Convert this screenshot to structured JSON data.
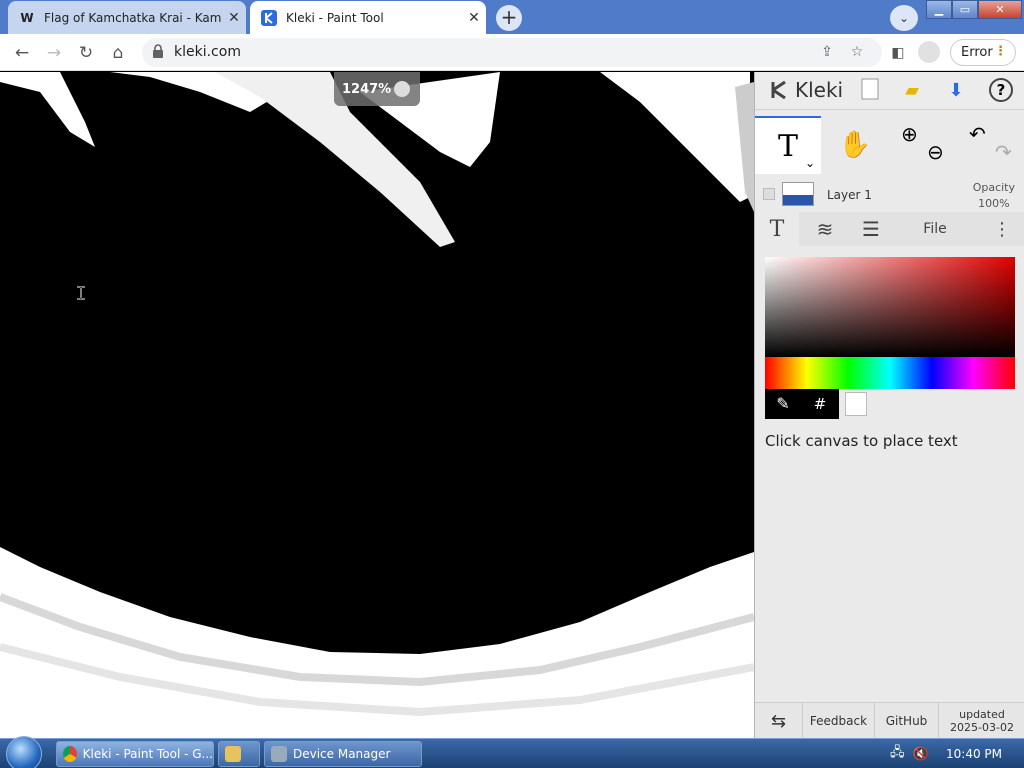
{
  "browser": {
    "tabs": [
      {
        "favicon": "W",
        "title": "Flag of Kamchatka Krai - Kamchatka",
        "active": false
      },
      {
        "favicon": "kleki-icon",
        "title": "Kleki - Paint Tool",
        "active": true
      }
    ],
    "url": "kleki.com",
    "error_label": "Error"
  },
  "canvas": {
    "zoom": "1247%"
  },
  "panel": {
    "logo": "Kleki",
    "layer": {
      "name": "Layer 1",
      "opacity_label": "Opacity",
      "opacity_value": "100%"
    },
    "tabs": {
      "text": "T",
      "file": "File"
    },
    "hex_label": "#",
    "hint": "Click canvas to place text",
    "footer": {
      "feedback": "Feedback",
      "github": "GitHub",
      "updated_label": "updated",
      "updated_date": "2025-03-02"
    }
  },
  "taskbar": {
    "items": [
      {
        "label": "Kleki - Paint Tool - G..."
      },
      {
        "label": ""
      },
      {
        "label": "Device Manager"
      }
    ],
    "clock": "10:40 PM"
  },
  "colors": {
    "accent": "#2d6be0",
    "picker_hue": "#e00000",
    "current_color": "#ffffff"
  }
}
